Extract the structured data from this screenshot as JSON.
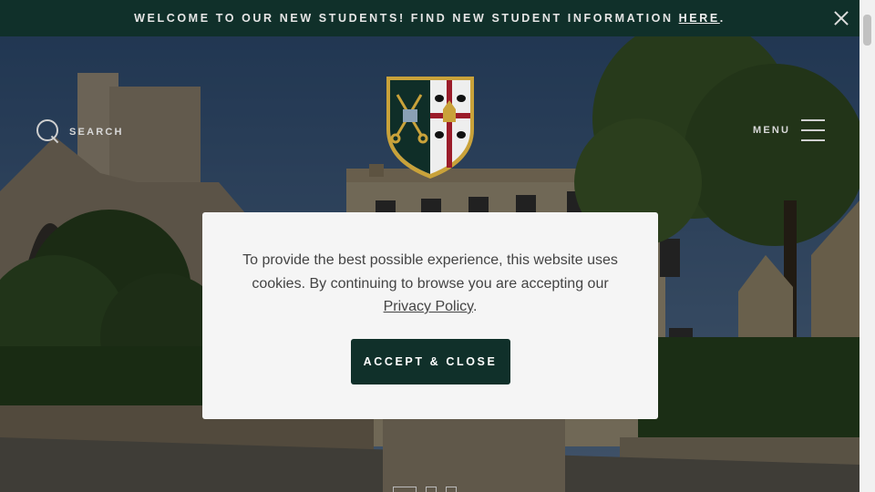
{
  "announcement": {
    "text": "WELCOME TO OUR NEW STUDENTS! FIND NEW STUDENT INFORMATION",
    "link": "HERE",
    "tail": "."
  },
  "header": {
    "search_label": "SEARCH",
    "menu_label": "MENU"
  },
  "cookie": {
    "message": "To provide the best possible experience, this website uses cookies. By continuing to browse you are accepting our",
    "policy_link": "Privacy Policy",
    "policy_tail": ".",
    "accept_label": "ACCEPT & CLOSE"
  },
  "colors": {
    "brand_green": "#10302a",
    "crest_gold": "#c9a23a",
    "crest_red": "#9b1c2a"
  }
}
